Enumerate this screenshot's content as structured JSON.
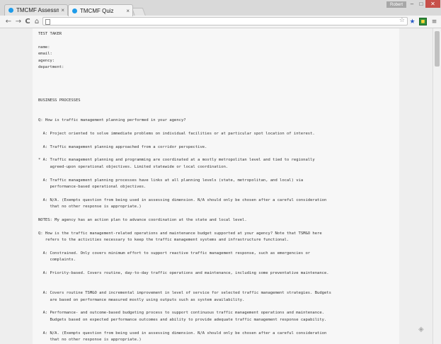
{
  "window": {
    "user": "Robert",
    "minimize": "–",
    "maximize": "□",
    "close": "✕"
  },
  "tabs": [
    {
      "label": "TMCMF Assessment",
      "close": "×"
    },
    {
      "label": "TMCMF Quiz",
      "close": "×"
    }
  ],
  "toolbar": {
    "back": "←",
    "forward": "→",
    "reload": "C",
    "home": "⌂",
    "address_value": "",
    "star": "☆",
    "bookmark_star": "★",
    "menu": "≡"
  },
  "document": {
    "lines": [
      "TEST TAKER",
      "",
      "name:",
      "email:",
      "agency:",
      "department:",
      "",
      "",
      "",
      "",
      "BUSINESS PROCESSES",
      "",
      "",
      "Q: How is traffic management planning performed in your agency?",
      "",
      "  A: Project oriented to solve immediate problems on individual facilities or at particular spot location of interest.",
      "",
      "  A: Traffic management planning approached from a corridor perspective.",
      "",
      "* A: Traffic management planning and programming are coordinated at a mostly metropolitan level and tied to regionally",
      "     agreed-upon operational objectives. Limited statewide or local coordination.",
      "",
      "  A: Traffic management planning processes have links at all planning levels (state, metropolitan, and local) via",
      "     performance-based operational objectives.",
      "",
      "  A: N/A. (Exempts question from being used in assessing dimension. N/A should only be chosen after a careful consideration",
      "     that no other response is appropriate.)",
      "",
      "NOTES: My agency has an action plan to advance coordination at the state and local level.",
      "",
      "Q: How is the traffic management-related operations and maintenance budget supported at your agency? Note that TSM&O here",
      "   refers to the activities necessary to keep the traffic management systems and infrastructure functional.",
      "",
      "  A: Constrained. Only covers minimum effort to support reactive traffic management response, such as emergencies or",
      "     complaints.",
      "",
      "  A: Priority-based. Covers routine, day-to-day traffic operations and maintenance, including some preventative maintenance.",
      "",
      "",
      "  A: Covers routine TSM&O and incremental improvement in level of service for selected traffic management strategies. Budgets",
      "     are based on performance measured mostly using outputs such as system availability.",
      "",
      "  A: Performance- and outcome-based budgeting process to support continuous traffic management operations and maintenance.",
      "     Budgets based on expected performance outcomes and ability to provide adequate traffic management response capability.",
      "",
      "  A: N/A. (Exempts question from being used in assessing dimension. N/A should only be chosen after a careful consideration",
      "     that no other response is appropriate.)"
    ]
  }
}
